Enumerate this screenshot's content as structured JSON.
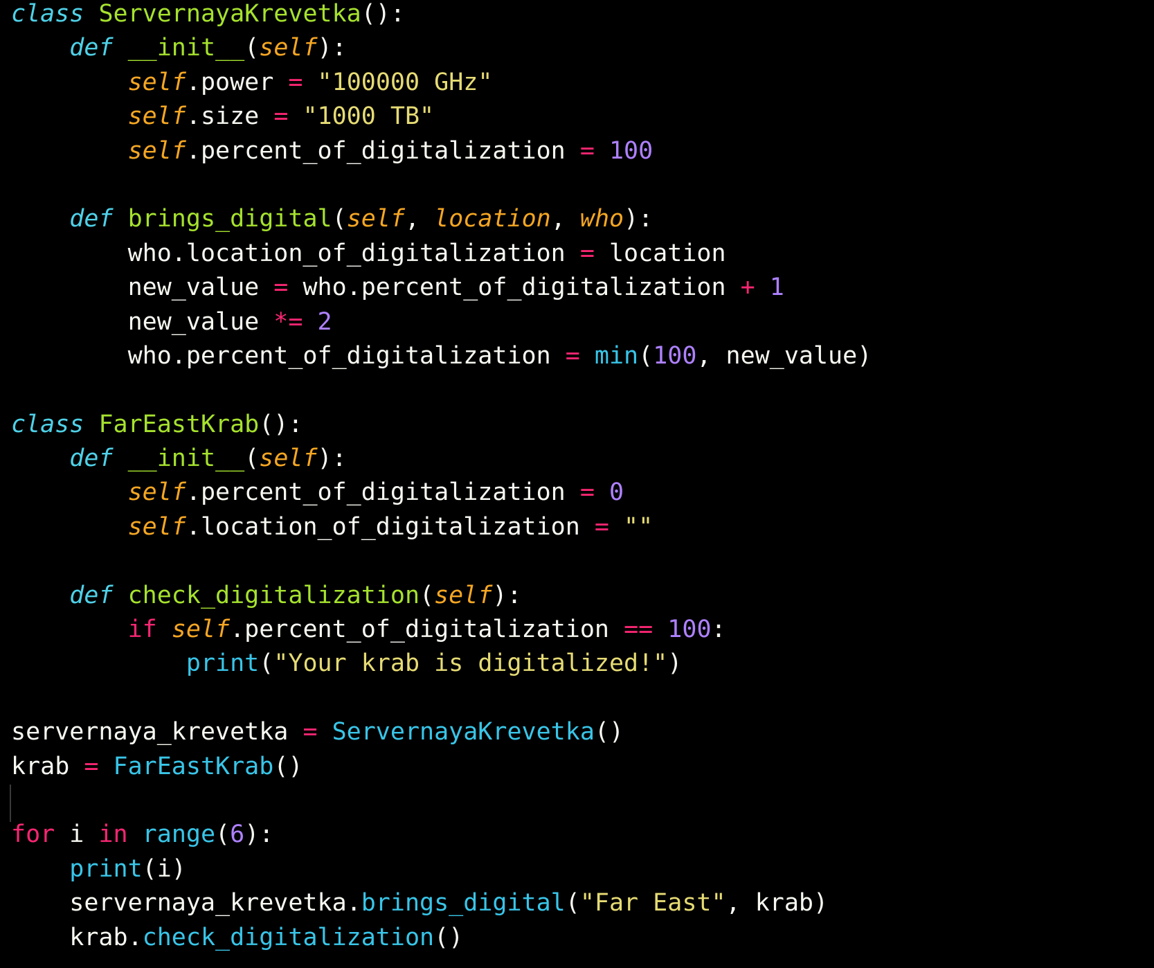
{
  "colors": {
    "background": "#000000",
    "default": "#f8f8f2",
    "keyword": "#4fd1e8",
    "control_keyword": "#f92672",
    "function_name": "#a6e22e",
    "self_param": "#f5a623",
    "string": "#e6db74",
    "number": "#ae81ff",
    "operator": "#f92672",
    "builtin": "#39c5e8"
  },
  "code_lines": [
    [
      {
        "t": "class",
        "c": "keyword",
        "i": true
      },
      {
        "t": " ",
        "c": "default"
      },
      {
        "t": "ServernayaKrevetka",
        "c": "function_name"
      },
      {
        "t": "():",
        "c": "default"
      }
    ],
    [
      {
        "t": "    ",
        "c": "default"
      },
      {
        "t": "def",
        "c": "keyword",
        "i": true
      },
      {
        "t": " ",
        "c": "default"
      },
      {
        "t": "__init__",
        "c": "function_name"
      },
      {
        "t": "(",
        "c": "default"
      },
      {
        "t": "self",
        "c": "self_param",
        "i": true
      },
      {
        "t": "):",
        "c": "default"
      }
    ],
    [
      {
        "t": "        ",
        "c": "default"
      },
      {
        "t": "self",
        "c": "self_param",
        "i": true
      },
      {
        "t": ".power ",
        "c": "default"
      },
      {
        "t": "=",
        "c": "operator"
      },
      {
        "t": " ",
        "c": "default"
      },
      {
        "t": "\"100000 GHz\"",
        "c": "string"
      }
    ],
    [
      {
        "t": "        ",
        "c": "default"
      },
      {
        "t": "self",
        "c": "self_param",
        "i": true
      },
      {
        "t": ".size ",
        "c": "default"
      },
      {
        "t": "=",
        "c": "operator"
      },
      {
        "t": " ",
        "c": "default"
      },
      {
        "t": "\"1000 TB\"",
        "c": "string"
      }
    ],
    [
      {
        "t": "        ",
        "c": "default"
      },
      {
        "t": "self",
        "c": "self_param",
        "i": true
      },
      {
        "t": ".percent_of_digitalization ",
        "c": "default"
      },
      {
        "t": "=",
        "c": "operator"
      },
      {
        "t": " ",
        "c": "default"
      },
      {
        "t": "100",
        "c": "number"
      }
    ],
    [],
    [
      {
        "t": "    ",
        "c": "default"
      },
      {
        "t": "def",
        "c": "keyword",
        "i": true
      },
      {
        "t": " ",
        "c": "default"
      },
      {
        "t": "brings_digital",
        "c": "function_name"
      },
      {
        "t": "(",
        "c": "default"
      },
      {
        "t": "self",
        "c": "self_param",
        "i": true
      },
      {
        "t": ", ",
        "c": "default"
      },
      {
        "t": "location",
        "c": "self_param",
        "i": true
      },
      {
        "t": ", ",
        "c": "default"
      },
      {
        "t": "who",
        "c": "self_param",
        "i": true
      },
      {
        "t": "):",
        "c": "default"
      }
    ],
    [
      {
        "t": "        who.location_of_digitalization ",
        "c": "default"
      },
      {
        "t": "=",
        "c": "operator"
      },
      {
        "t": " location",
        "c": "default"
      }
    ],
    [
      {
        "t": "        new_value ",
        "c": "default"
      },
      {
        "t": "=",
        "c": "operator"
      },
      {
        "t": " who.percent_of_digitalization ",
        "c": "default"
      },
      {
        "t": "+",
        "c": "operator"
      },
      {
        "t": " ",
        "c": "default"
      },
      {
        "t": "1",
        "c": "number"
      }
    ],
    [
      {
        "t": "        new_value ",
        "c": "default"
      },
      {
        "t": "*=",
        "c": "operator"
      },
      {
        "t": " ",
        "c": "default"
      },
      {
        "t": "2",
        "c": "number"
      }
    ],
    [
      {
        "t": "        who.percent_of_digitalization ",
        "c": "default"
      },
      {
        "t": "=",
        "c": "operator"
      },
      {
        "t": " ",
        "c": "default"
      },
      {
        "t": "min",
        "c": "builtin"
      },
      {
        "t": "(",
        "c": "default"
      },
      {
        "t": "100",
        "c": "number"
      },
      {
        "t": ", new_value)",
        "c": "default"
      }
    ],
    [],
    [
      {
        "t": "class",
        "c": "keyword",
        "i": true
      },
      {
        "t": " ",
        "c": "default"
      },
      {
        "t": "FarEastKrab",
        "c": "function_name"
      },
      {
        "t": "():",
        "c": "default"
      }
    ],
    [
      {
        "t": "    ",
        "c": "default"
      },
      {
        "t": "def",
        "c": "keyword",
        "i": true
      },
      {
        "t": " ",
        "c": "default"
      },
      {
        "t": "__init__",
        "c": "function_name"
      },
      {
        "t": "(",
        "c": "default"
      },
      {
        "t": "self",
        "c": "self_param",
        "i": true
      },
      {
        "t": "):",
        "c": "default"
      }
    ],
    [
      {
        "t": "        ",
        "c": "default"
      },
      {
        "t": "self",
        "c": "self_param",
        "i": true
      },
      {
        "t": ".percent_of_digitalization ",
        "c": "default"
      },
      {
        "t": "=",
        "c": "operator"
      },
      {
        "t": " ",
        "c": "default"
      },
      {
        "t": "0",
        "c": "number"
      }
    ],
    [
      {
        "t": "        ",
        "c": "default"
      },
      {
        "t": "self",
        "c": "self_param",
        "i": true
      },
      {
        "t": ".location_of_digitalization ",
        "c": "default"
      },
      {
        "t": "=",
        "c": "operator"
      },
      {
        "t": " ",
        "c": "default"
      },
      {
        "t": "\"\"",
        "c": "string"
      }
    ],
    [],
    [
      {
        "t": "    ",
        "c": "default"
      },
      {
        "t": "def",
        "c": "keyword",
        "i": true
      },
      {
        "t": " ",
        "c": "default"
      },
      {
        "t": "check_digitalization",
        "c": "function_name"
      },
      {
        "t": "(",
        "c": "default"
      },
      {
        "t": "self",
        "c": "self_param",
        "i": true
      },
      {
        "t": "):",
        "c": "default"
      }
    ],
    [
      {
        "t": "        ",
        "c": "default"
      },
      {
        "t": "if",
        "c": "control_keyword"
      },
      {
        "t": " ",
        "c": "default"
      },
      {
        "t": "self",
        "c": "self_param",
        "i": true
      },
      {
        "t": ".percent_of_digitalization ",
        "c": "default"
      },
      {
        "t": "==",
        "c": "operator"
      },
      {
        "t": " ",
        "c": "default"
      },
      {
        "t": "100",
        "c": "number"
      },
      {
        "t": ":",
        "c": "default"
      }
    ],
    [
      {
        "t": "            ",
        "c": "default"
      },
      {
        "t": "print",
        "c": "builtin"
      },
      {
        "t": "(",
        "c": "default"
      },
      {
        "t": "\"Your krab is digitalized!\"",
        "c": "string"
      },
      {
        "t": ")",
        "c": "default"
      }
    ],
    [],
    [
      {
        "t": "servernaya_krevetka ",
        "c": "default"
      },
      {
        "t": "=",
        "c": "operator"
      },
      {
        "t": " ",
        "c": "default"
      },
      {
        "t": "ServernayaKrevetka",
        "c": "builtin"
      },
      {
        "t": "()",
        "c": "default"
      }
    ],
    [
      {
        "t": "krab ",
        "c": "default"
      },
      {
        "t": "=",
        "c": "operator"
      },
      {
        "t": " ",
        "c": "default"
      },
      {
        "t": "FarEastKrab",
        "c": "builtin"
      },
      {
        "t": "()",
        "c": "default"
      }
    ],
    [],
    [
      {
        "t": "for",
        "c": "control_keyword"
      },
      {
        "t": " i ",
        "c": "default"
      },
      {
        "t": "in",
        "c": "control_keyword"
      },
      {
        "t": " ",
        "c": "default"
      },
      {
        "t": "range",
        "c": "builtin"
      },
      {
        "t": "(",
        "c": "default"
      },
      {
        "t": "6",
        "c": "number"
      },
      {
        "t": "):",
        "c": "default"
      }
    ],
    [
      {
        "t": "    ",
        "c": "default"
      },
      {
        "t": "print",
        "c": "builtin"
      },
      {
        "t": "(i)",
        "c": "default"
      }
    ],
    [
      {
        "t": "    servernaya_krevetka.",
        "c": "default"
      },
      {
        "t": "brings_digital",
        "c": "builtin"
      },
      {
        "t": "(",
        "c": "default"
      },
      {
        "t": "\"Far East\"",
        "c": "string"
      },
      {
        "t": ", krab)",
        "c": "default"
      }
    ],
    [
      {
        "t": "    krab.",
        "c": "default"
      },
      {
        "t": "check_digitalization",
        "c": "builtin"
      },
      {
        "t": "()",
        "c": "default"
      }
    ]
  ]
}
